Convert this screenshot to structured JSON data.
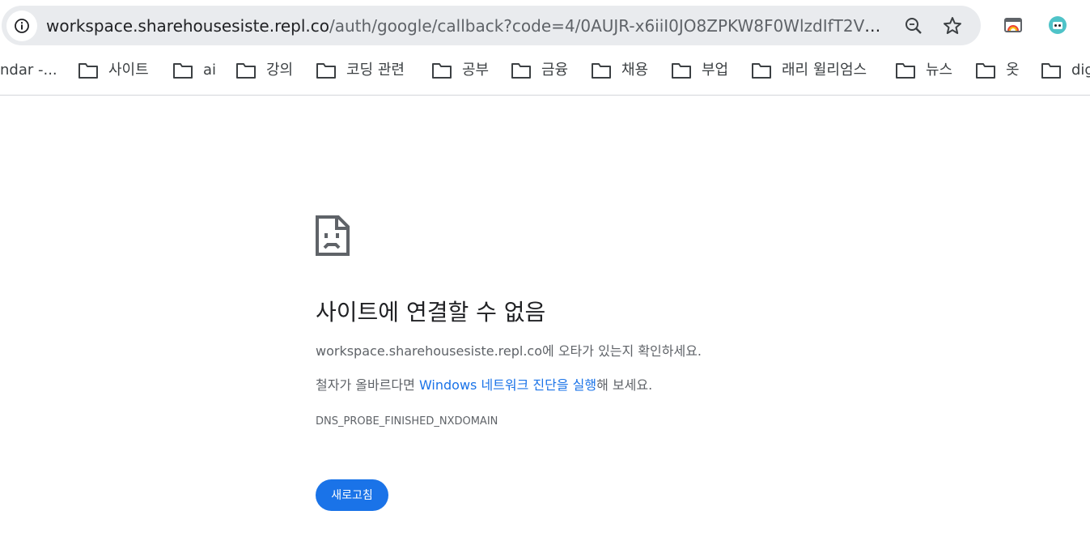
{
  "browser": {
    "url_host": "workspace.sharehousesiste.repl.co",
    "url_path": "/auth/google/callback?code=4/0AUJR-x6iiI0JO8ZPKW8F0WlzdIfT2VKYiwh...",
    "icons": {
      "site_info": "info-icon",
      "zoom": "zoom-icon",
      "bookmark_star": "star-icon",
      "extension_1": "extension-icon",
      "extension_2": "extension-icon"
    }
  },
  "bookmarks": [
    {
      "label": "ndar -..."
    },
    {
      "label": "사이트"
    },
    {
      "label": "ai"
    },
    {
      "label": "강의"
    },
    {
      "label": "코딩 관련"
    },
    {
      "label": "공부"
    },
    {
      "label": "금융"
    },
    {
      "label": "채용"
    },
    {
      "label": "부업"
    },
    {
      "label": "래리 윌리엄스"
    },
    {
      "label": "뉴스"
    },
    {
      "label": "옷"
    },
    {
      "label": "dig"
    }
  ],
  "error": {
    "heading": "사이트에 연결할 수 없음",
    "host": "workspace.sharehousesiste.repl.co",
    "typo_suffix": "에 오타가 있는지 확인하세요.",
    "line2_prefix": "철자가 올바르다면 ",
    "diagnostics_link": "Windows 네트워크 진단을 실행",
    "line2_suffix": "해 보세요.",
    "code": "DNS_PROBE_FINISHED_NXDOMAIN",
    "reload_label": "새로고침"
  },
  "colors": {
    "link": "#1a73e8",
    "button_bg": "#1a73e8",
    "omnibox_bg": "#e9ebee"
  }
}
